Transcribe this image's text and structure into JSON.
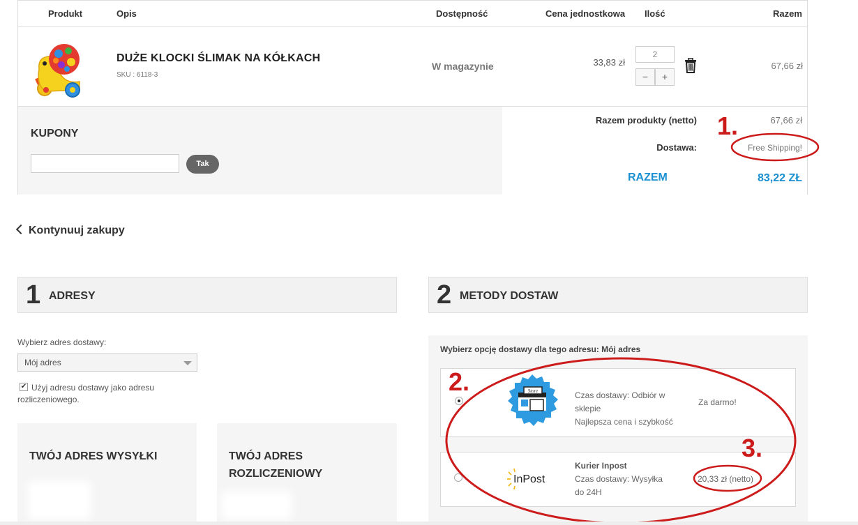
{
  "cart": {
    "headers": {
      "product": "Produkt",
      "description": "Opis",
      "availability": "Dostępność",
      "unit_price": "Cena jednostkowa",
      "quantity": "Ilość",
      "total": "Razem"
    },
    "item": {
      "name": "DUŻE KLOCKI ŚLIMAK NA KÓŁKACH",
      "sku": "SKU : 6118-3",
      "availability": "W magazynie",
      "unit_price": "33,83 zł",
      "quantity": "2",
      "minus": "−",
      "plus": "+",
      "total": "67,66 zł"
    },
    "coupons": {
      "title": "KUPONY",
      "input_value": "",
      "button": "Tak"
    },
    "summary": {
      "products_label": "Razem produkty (netto)",
      "products_value": "67,66 zł",
      "shipping_label": "Dostawa:",
      "shipping_value": "Free Shipping!",
      "total_label": "RAZEM",
      "total_value": "83,22 ZŁ"
    }
  },
  "continue_link": "Kontynuuj zakupy",
  "step1": {
    "number": "1",
    "title": "ADRESY",
    "select_label": "Wybierz adres dostawy:",
    "select_value": "Mój adres",
    "checkbox_checked": true,
    "checkbox_label": "Użyj adresu dostawy jako adresu rozliczeniowego.",
    "shipping_address_title": "TWÓJ ADRES WYSYŁKI",
    "billing_address_title": "TWÓJ ADRES ROZLICZENIOWY"
  },
  "step2": {
    "number": "2",
    "title": "METODY DOSTAW",
    "prompt": "Wybierz opcję dostawy dla tego adresu: Mój adres",
    "options": [
      {
        "logo": "store-badge-icon",
        "logo_text": "Store",
        "selected": true,
        "line1": "Czas dostawy: Odbiór w",
        "line2": "sklepie",
        "line3": "Najlepsza cena i szybkość",
        "price": "Za darmo!"
      },
      {
        "logo": "inpost-logo",
        "logo_text": "InPost",
        "selected": false,
        "name": "Kurier Inpost",
        "line1": "Czas dostawy: Wysyłka",
        "line2": "do 24H",
        "price": "20,33 zł (netto)"
      }
    ]
  },
  "annotations": {
    "n1": "1.",
    "n2": "2.",
    "n3": "3."
  },
  "colors": {
    "accent_blue": "#1a8fd1",
    "annotation_red": "#cc1b1b",
    "panel_gray": "#f5f5f5"
  }
}
